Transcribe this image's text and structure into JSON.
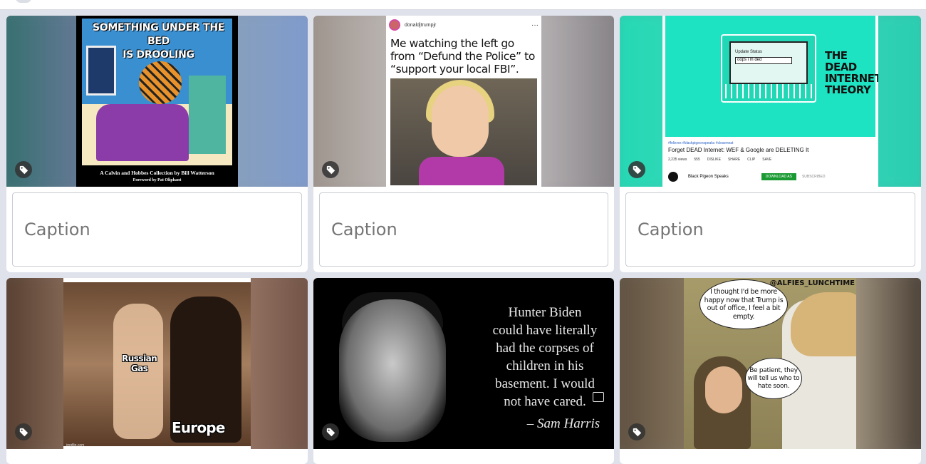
{
  "caption_placeholder": "Caption",
  "cards": [
    {
      "title_line1": "SOMETHING UNDER THE BED",
      "title_line2": "IS DROOLING",
      "footer_line1": "A Calvin and Hobbes Collection by Bill Watterson",
      "footer_line2": "Foreword by Pat Oliphant"
    },
    {
      "handle": "donaldjtrumpjr",
      "menu": "···",
      "text": "Me watching the left go from “Defund the Police” to “support your local FBI”."
    },
    {
      "screen_label": "Update Status",
      "screen_value": "oops i m ded",
      "side_title": "THE DEAD INTERNET THEORY",
      "hashtags": "#felixrex #blackpigeonspeaks #clearmeat",
      "video_title": "Forget DEAD Internet: WEF & Google are DELETING It",
      "views": "2,235 views",
      "likes": "555",
      "dislike": "DISLIKE",
      "share": "SHARE",
      "clip": "CLIP",
      "save": "SAVE",
      "channel": "Black Pigeon Speaks",
      "download": "DOWNLOAD AS",
      "subscribed": "SUBSCRIBED"
    },
    {
      "label1_line1": "Russian",
      "label1_line2": "Gas",
      "label2": "Europe",
      "watermark": "imgflip.com"
    },
    {
      "quote_lines": [
        "Hunter Biden",
        "could have literally",
        "had the corpses of",
        "children in his",
        "basement. I would",
        "not have cared."
      ],
      "attribution": "– Sam Harris"
    },
    {
      "handle": "@ALFIES_LUNCHTIME",
      "bubble1": "I thought I'd be more happy now that Trump is out of office, I feel a bit empty.",
      "bubble2": "Be patient, they will tell us who to hate soon."
    }
  ]
}
